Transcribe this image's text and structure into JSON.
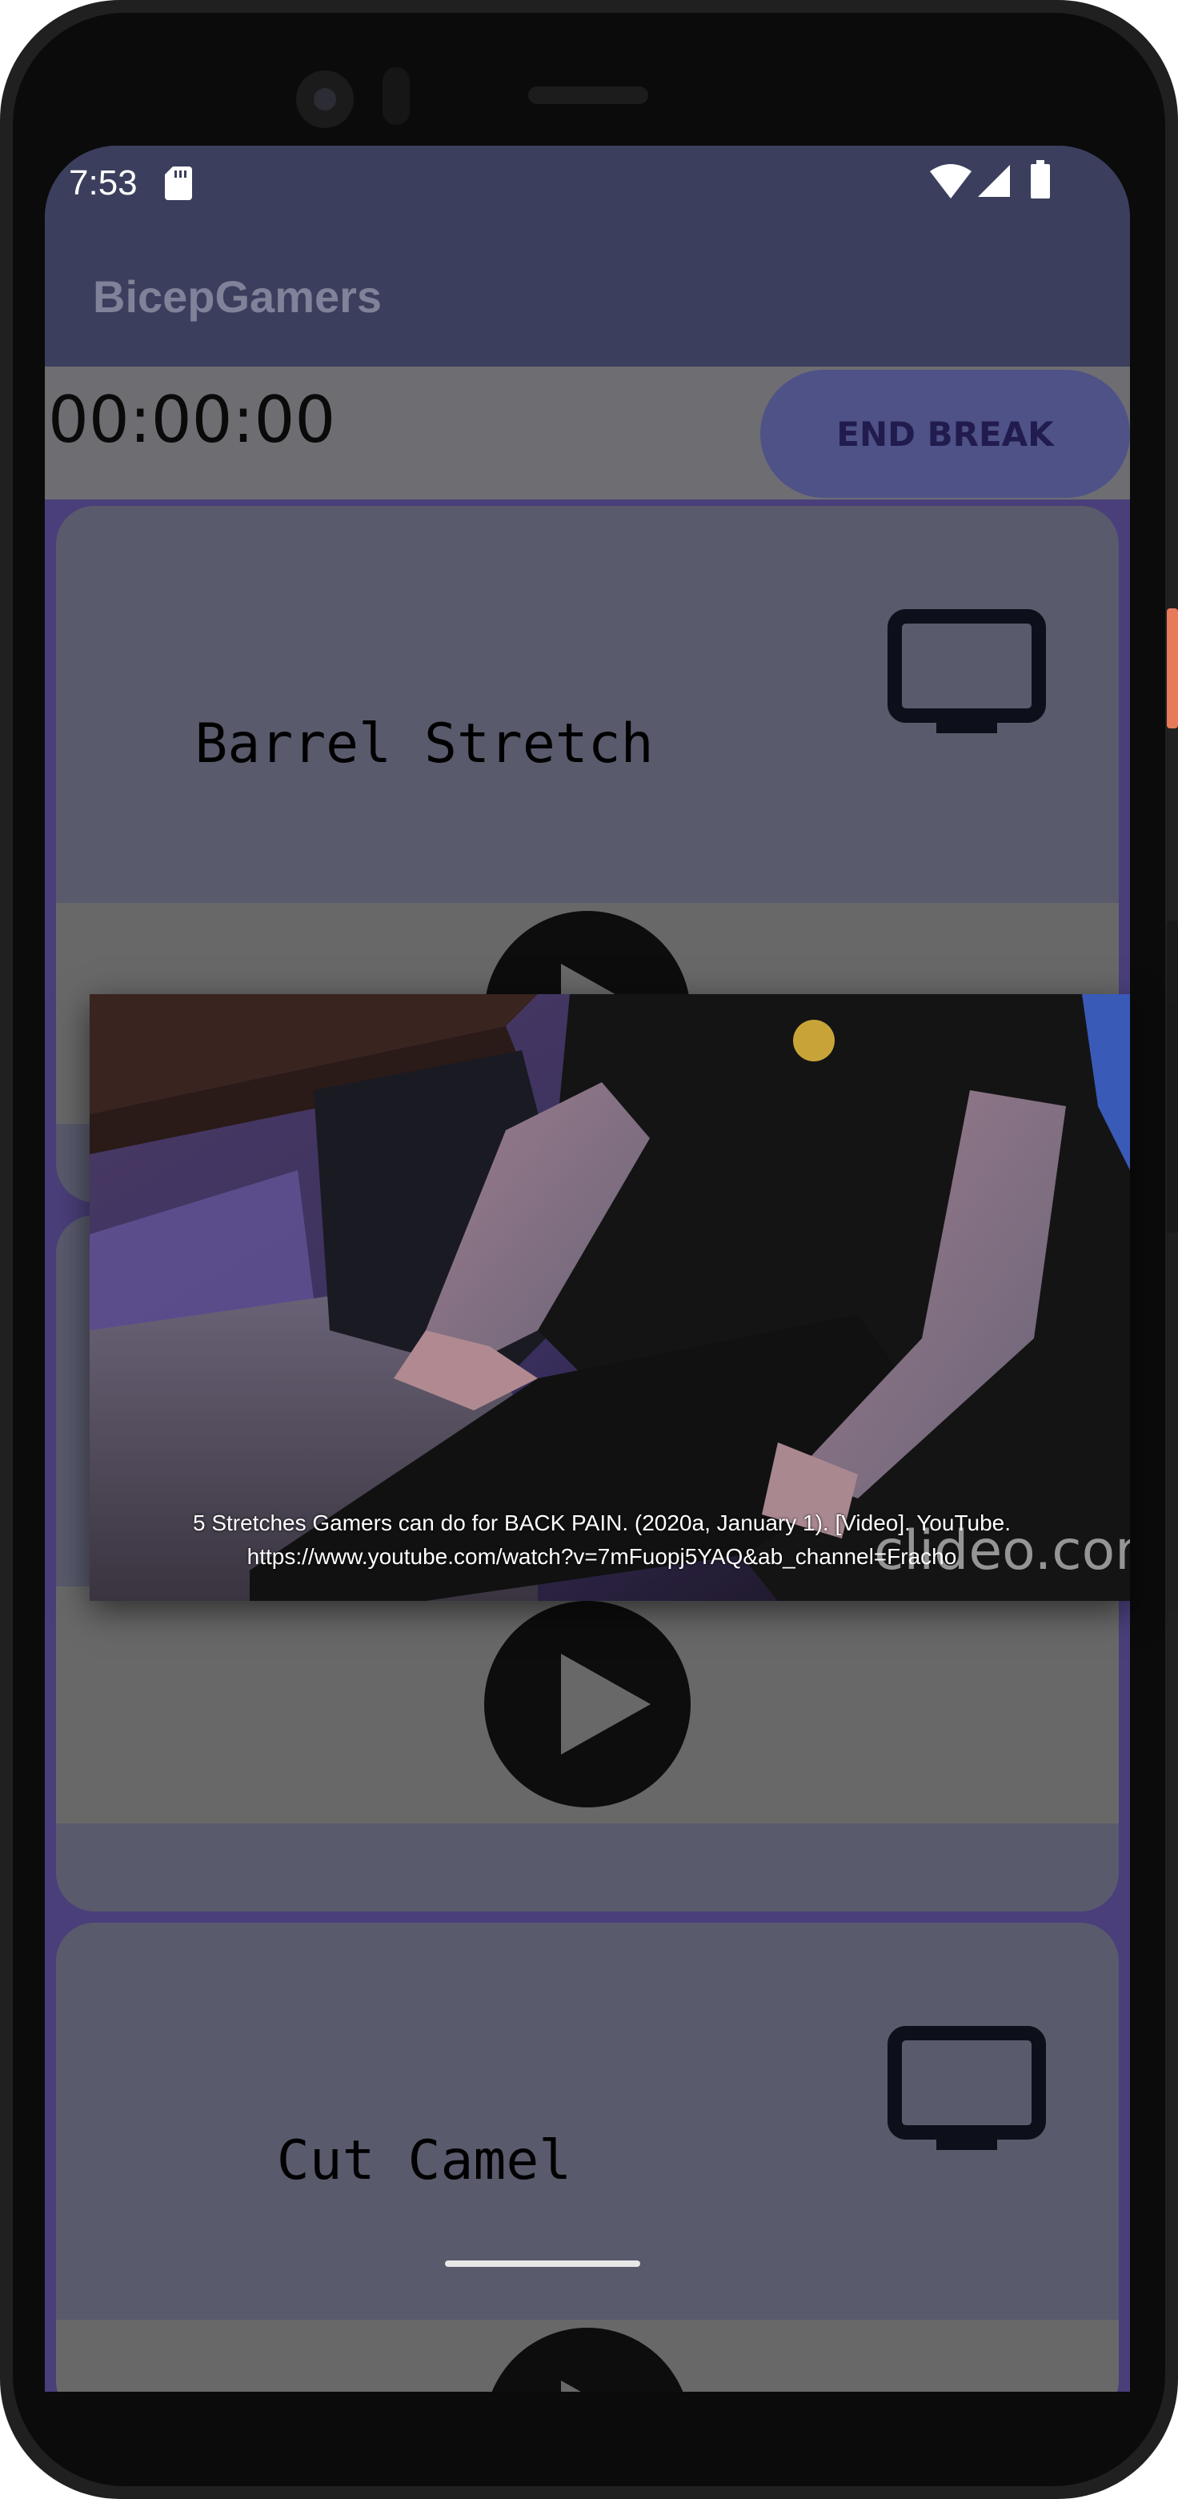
{
  "status_bar": {
    "time": "7:53"
  },
  "app_bar": {
    "title": "BicepGamers"
  },
  "timer": {
    "value": "00:00:00",
    "end_break_label": "END BREAK"
  },
  "cards": [
    {
      "title": "Barrel Stretch"
    },
    {
      "title": "Cut Camel"
    }
  ],
  "video_popup": {
    "caption_line1": "5 Stretches Gamers can do for BACK PAIN. (2020a, January 1). [Video]. YouTube.",
    "caption_line2": "https://www.youtube.com/watch?v=7mFuopj5YAQ&ab_channel=Fracho",
    "watermark": "clideo.com"
  },
  "colors": {
    "status_bar": "#3b3f5d",
    "end_break_button": "#4e5287",
    "card": "#595a6c",
    "player_area": "#686868"
  }
}
